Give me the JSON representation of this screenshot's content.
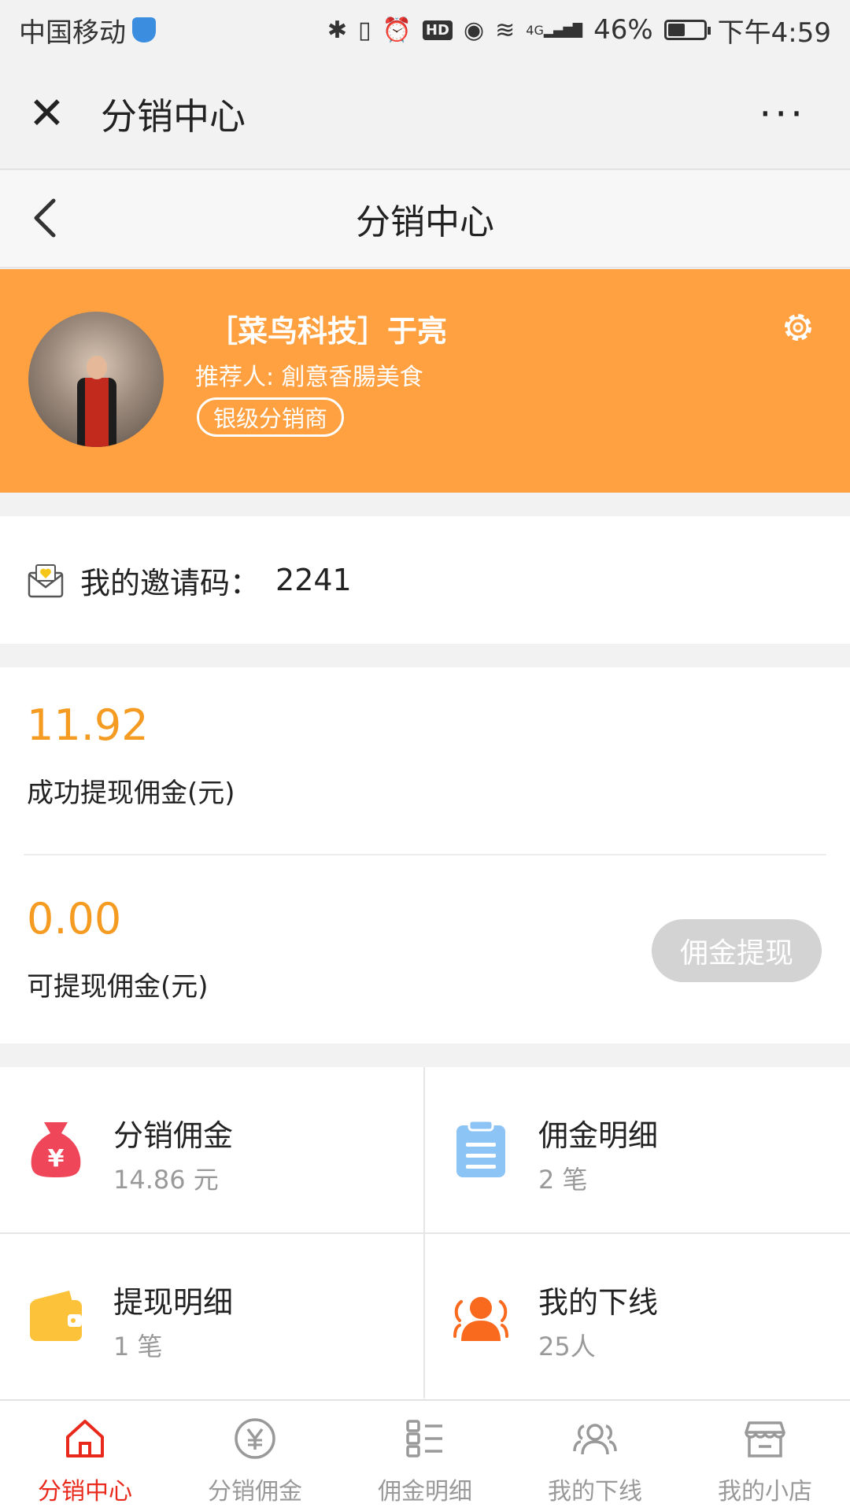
{
  "status_bar": {
    "carrier": "中国移动",
    "network": "4G",
    "hd": "HD",
    "battery": "46%",
    "battery_level": 0.46,
    "time": "下午4:59"
  },
  "wechat_bar": {
    "title": "分销中心",
    "more": "···"
  },
  "nav": {
    "title": "分销中心"
  },
  "profile": {
    "name": "［菜鸟科技］于亮",
    "referrer": "推荐人: 創意香腸美食",
    "level": "银级分销商"
  },
  "invite": {
    "label": "我的邀请码：",
    "code": "2241"
  },
  "earnings": {
    "withdrawn_amount": "11.92",
    "withdrawn_label": "成功提现佣金(元)",
    "available_amount": "0.00",
    "available_label": "可提现佣金(元)",
    "withdraw_button": "佣金提现"
  },
  "grid": [
    {
      "title": "分销佣金",
      "sub": "14.86 元",
      "icon": "money-bag-icon",
      "color": "#f0465a"
    },
    {
      "title": "佣金明细",
      "sub": "2 笔",
      "icon": "clipboard-icon",
      "color": "#8cc4f5"
    },
    {
      "title": "提现明细",
      "sub": "1 笔",
      "icon": "wallet-icon",
      "color": "#fcc23a"
    },
    {
      "title": "我的下线",
      "sub": "25人",
      "icon": "team-icon",
      "color": "#fa6a1e"
    }
  ],
  "tabs": [
    {
      "label": "分销中心",
      "icon": "home-icon",
      "active": true
    },
    {
      "label": "分销佣金",
      "icon": "yen-circle-icon",
      "active": false
    },
    {
      "label": "佣金明细",
      "icon": "list-icon",
      "active": false
    },
    {
      "label": "我的下线",
      "icon": "team-icon",
      "active": false
    },
    {
      "label": "我的小店",
      "icon": "shop-icon",
      "active": false
    }
  ],
  "colors": {
    "accent_orange": "#ffa140",
    "amount_orange": "#f59b22",
    "tab_active_red": "#e8291b",
    "tab_inactive": "#999999"
  }
}
